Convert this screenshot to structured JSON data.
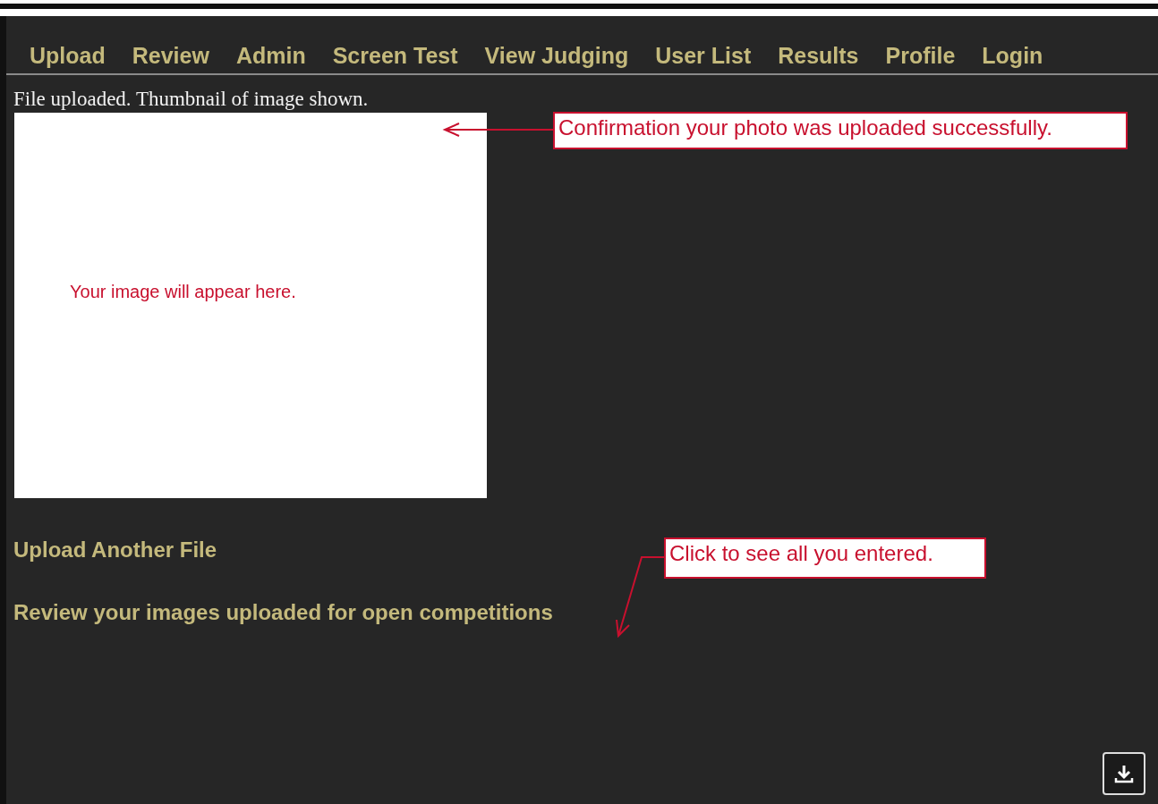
{
  "nav": {
    "items": [
      "Upload",
      "Review",
      "Admin",
      "Screen Test",
      "View Judging",
      "User List",
      "Results",
      "Profile",
      "Login"
    ]
  },
  "status_message": "File uploaded. Thumbnail of image shown.",
  "thumbnail": {
    "placeholder_text": "Your image will appear here."
  },
  "links": [
    "Upload Another File",
    "Review your images uploaded for open competitions"
  ],
  "annotations": [
    {
      "kind": "straight",
      "text": "Confirmation your photo was uploaded successfully."
    },
    {
      "kind": "bent",
      "text": "Click to see all you entered."
    }
  ]
}
